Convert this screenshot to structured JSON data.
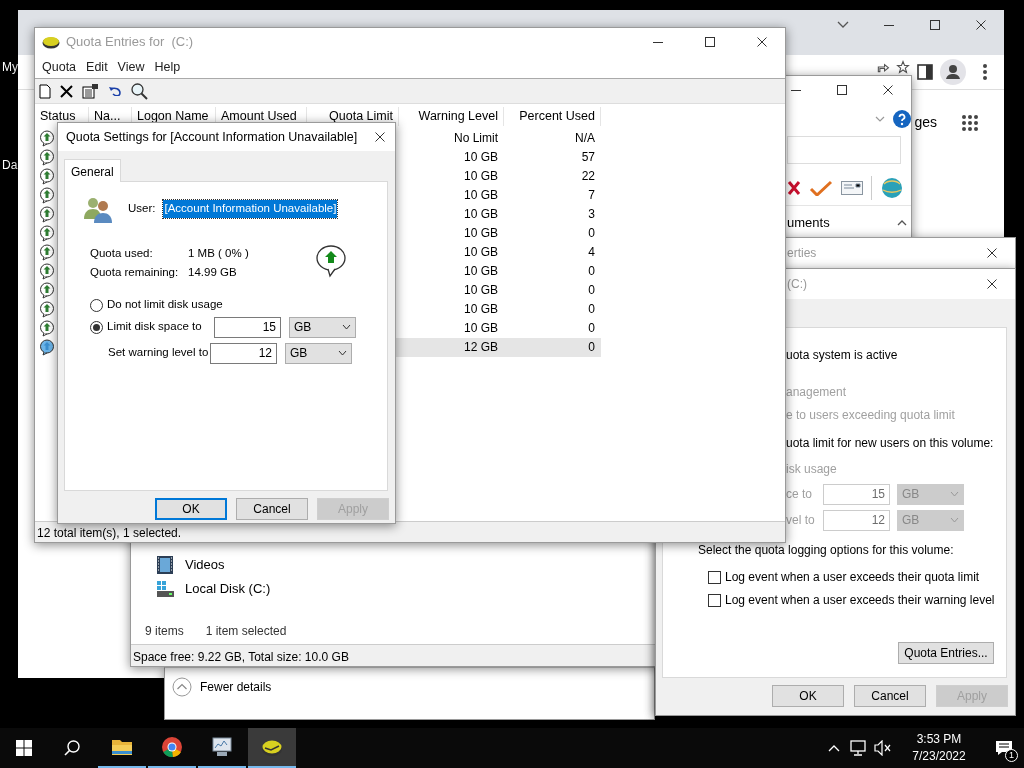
{
  "desktop": {
    "icon_labels": [
      "My",
      "Da"
    ]
  },
  "browser": {
    "visible_text": "ges"
  },
  "file_dialog": {
    "visible_text": "uments"
  },
  "properties_window": {
    "title": "erties"
  },
  "volume_quota_dialog": {
    "title": "(C:)",
    "lines": [
      {
        "text": "uota system is active",
        "disabled": false
      },
      {
        "text": "anagement",
        "disabled": true
      },
      {
        "text": "e to users exceeding quota limit",
        "disabled": true
      },
      {
        "text": "uota limit for new users on this volume:",
        "disabled": false
      },
      {
        "text": "isk usage",
        "disabled": true
      }
    ],
    "fields": [
      {
        "label": "ce to",
        "value": "15",
        "unit": "GB",
        "disabled": true
      },
      {
        "label": "vel to",
        "value": "12",
        "unit": "GB",
        "disabled": true
      }
    ],
    "logging_label": "Select the quota logging options for this volume:",
    "checkboxes": [
      {
        "label": "Log event when a user exceeds their quota limit",
        "checked": false
      },
      {
        "label": "Log event when a user exceeds their warning level",
        "checked": false
      }
    ],
    "entries_button": "Quota Entries...",
    "buttons": [
      {
        "label": "OK",
        "disabled": false
      },
      {
        "label": "Cancel",
        "disabled": false
      },
      {
        "label": "Apply",
        "disabled": true
      }
    ]
  },
  "explorer": {
    "nav_items": [
      {
        "label": "Videos",
        "kind": "videos"
      },
      {
        "label": "Local Disk (C:)",
        "kind": "disk"
      }
    ],
    "item_count": "9 items",
    "selection": "1 item selected",
    "status_bar": "Space free: 9.22 GB, Total size: 10.0 GB"
  },
  "task_manager": {
    "toggle": "Fewer details"
  },
  "quota_entries": {
    "title": "Quota Entries for  (C:)",
    "menu": [
      "Quota",
      "Edit",
      "View",
      "Help"
    ],
    "columns": [
      "Status",
      "Na...",
      "Logon Name",
      "Amount Used",
      "Quota Limit",
      "Warning Level",
      "Percent Used"
    ],
    "rows": [
      {
        "warning_level": "No Limit",
        "percent_used": "N/A",
        "selected": false
      },
      {
        "warning_level": "10 GB",
        "percent_used": "57",
        "selected": false
      },
      {
        "warning_level": "10 GB",
        "percent_used": "22",
        "selected": false
      },
      {
        "warning_level": "10 GB",
        "percent_used": "7",
        "selected": false
      },
      {
        "warning_level": "10 GB",
        "percent_used": "3",
        "selected": false
      },
      {
        "warning_level": "10 GB",
        "percent_used": "0",
        "selected": false
      },
      {
        "warning_level": "10 GB",
        "percent_used": "4",
        "selected": false
      },
      {
        "warning_level": "10 GB",
        "percent_used": "0",
        "selected": false
      },
      {
        "warning_level": "10 GB",
        "percent_used": "0",
        "selected": false
      },
      {
        "warning_level": "10 GB",
        "percent_used": "0",
        "selected": false
      },
      {
        "warning_level": "10 GB",
        "percent_used": "0",
        "selected": false
      },
      {
        "warning_level": "12 GB",
        "percent_used": "0",
        "selected": true
      }
    ],
    "status_bar": "12 total item(s), 1 selected."
  },
  "quota_settings": {
    "title": "Quota Settings for [Account Information Unavailable]",
    "tabs": [
      {
        "label": "General",
        "selected": true
      }
    ],
    "user_label": "User:",
    "user_value": "[Account Information Unavailable]",
    "stats": [
      {
        "label": "Quota used:",
        "value": "1 MB ( 0% )"
      },
      {
        "label": "Quota remaining:",
        "value": "14.99 GB"
      }
    ],
    "options": [
      {
        "label": "Do not limit disk usage",
        "selected": false
      },
      {
        "label": "Limit disk space to",
        "selected": true
      }
    ],
    "limit": {
      "value": "15",
      "unit": "GB"
    },
    "warning": {
      "label": "Set warning level to",
      "value": "12",
      "unit": "GB"
    },
    "buttons": [
      {
        "label": "OK",
        "default": true,
        "disabled": false
      },
      {
        "label": "Cancel",
        "default": false,
        "disabled": false
      },
      {
        "label": "Apply",
        "default": false,
        "disabled": true
      }
    ]
  },
  "taskbar": {
    "apps": [
      {
        "kind": "explorer",
        "active": false
      },
      {
        "kind": "browser",
        "active": false
      },
      {
        "kind": "monitor",
        "active": false
      },
      {
        "kind": "quota",
        "active": true
      }
    ],
    "time": "3:53 PM",
    "date": "7/23/2022",
    "notifications": "1"
  }
}
